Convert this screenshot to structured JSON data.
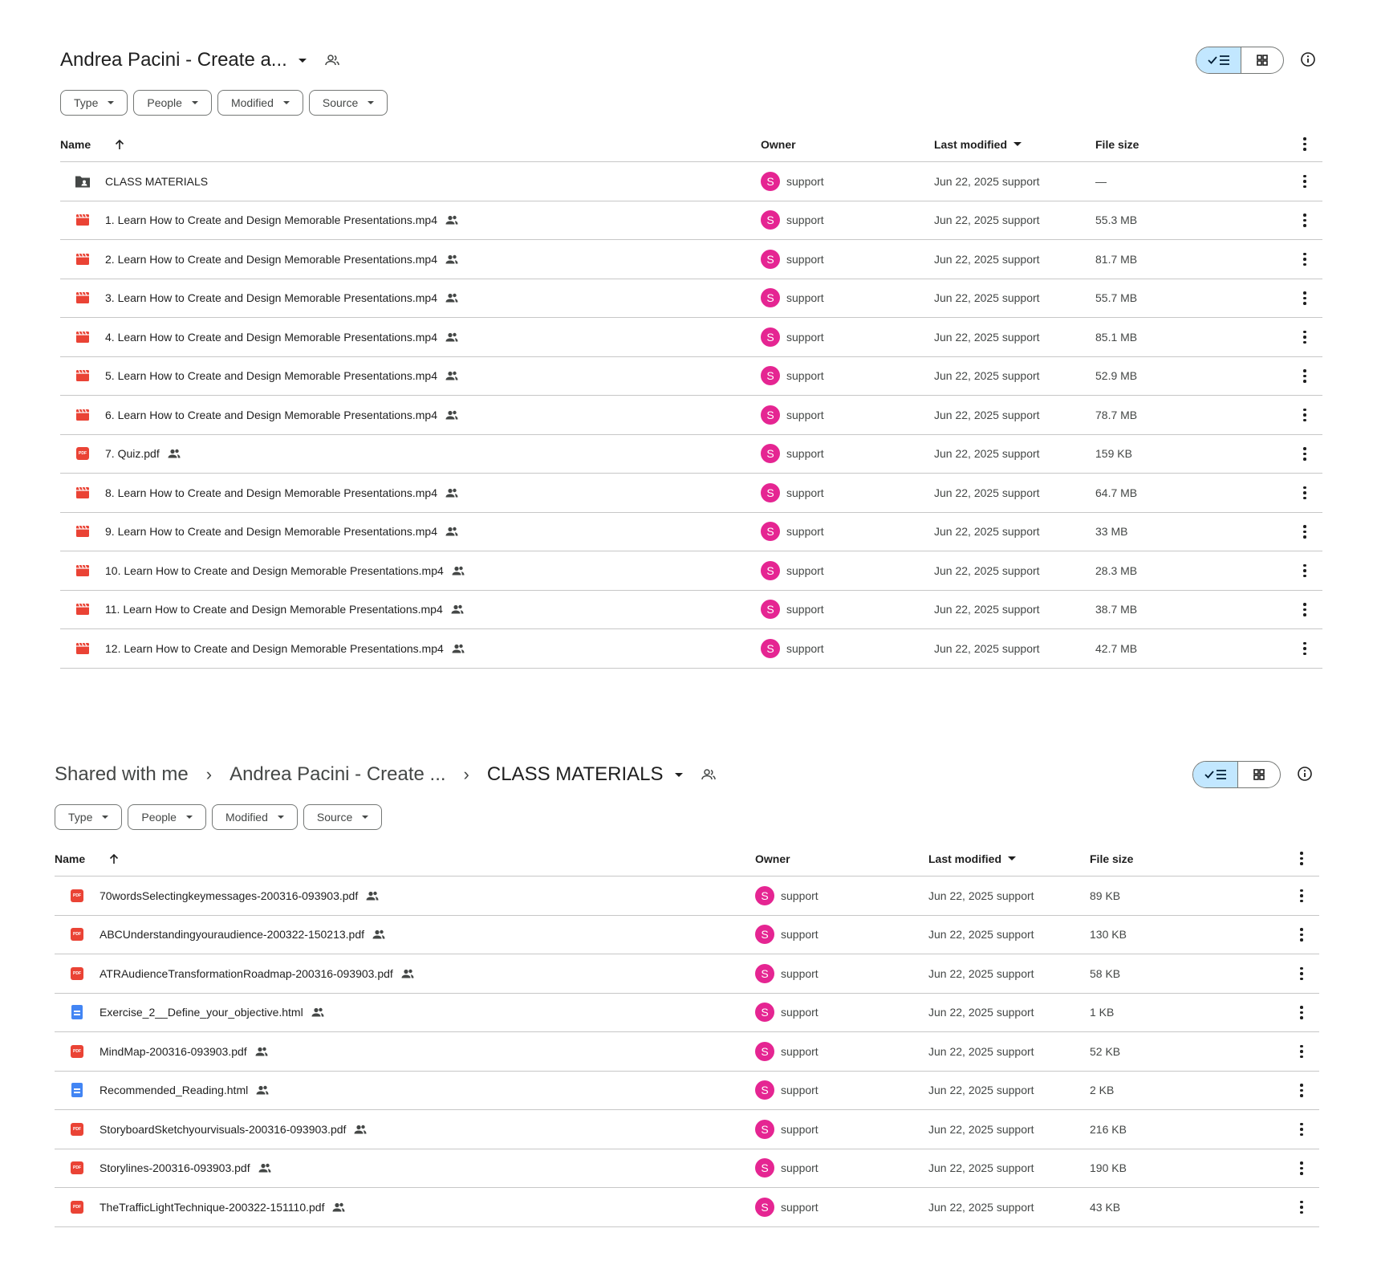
{
  "panel1": {
    "title": "Andrea Pacini - Create a...",
    "filters": [
      "Type",
      "People",
      "Modified",
      "Source"
    ],
    "columns": {
      "name": "Name",
      "owner": "Owner",
      "modified": "Last modified",
      "size": "File size"
    },
    "rows": [
      {
        "type": "shared-folder",
        "name": "CLASS MATERIALS",
        "shared": false,
        "owner": "support",
        "modified": "Jun 22, 2025 support",
        "size": "—"
      },
      {
        "type": "video",
        "name": "1. Learn How to Create and Design Memorable Presentations.mp4",
        "shared": true,
        "owner": "support",
        "modified": "Jun 22, 2025 support",
        "size": "55.3 MB"
      },
      {
        "type": "video",
        "name": "2. Learn How to Create and Design Memorable Presentations.mp4",
        "shared": true,
        "owner": "support",
        "modified": "Jun 22, 2025 support",
        "size": "81.7 MB"
      },
      {
        "type": "video",
        "name": "3. Learn How to Create and Design Memorable Presentations.mp4",
        "shared": true,
        "owner": "support",
        "modified": "Jun 22, 2025 support",
        "size": "55.7 MB"
      },
      {
        "type": "video",
        "name": "4. Learn How to Create and Design Memorable Presentations.mp4",
        "shared": true,
        "owner": "support",
        "modified": "Jun 22, 2025 support",
        "size": "85.1 MB"
      },
      {
        "type": "video",
        "name": "5. Learn How to Create and Design Memorable Presentations.mp4",
        "shared": true,
        "owner": "support",
        "modified": "Jun 22, 2025 support",
        "size": "52.9 MB"
      },
      {
        "type": "video",
        "name": "6. Learn How to Create and Design Memorable Presentations.mp4",
        "shared": true,
        "owner": "support",
        "modified": "Jun 22, 2025 support",
        "size": "78.7 MB"
      },
      {
        "type": "pdf",
        "name": "7. Quiz.pdf",
        "shared": true,
        "owner": "support",
        "modified": "Jun 22, 2025 support",
        "size": "159 KB"
      },
      {
        "type": "video",
        "name": "8. Learn How to Create and Design Memorable Presentations.mp4",
        "shared": true,
        "owner": "support",
        "modified": "Jun 22, 2025 support",
        "size": "64.7 MB"
      },
      {
        "type": "video",
        "name": "9. Learn How to Create and Design Memorable Presentations.mp4",
        "shared": true,
        "owner": "support",
        "modified": "Jun 22, 2025 support",
        "size": "33 MB"
      },
      {
        "type": "video",
        "name": "10. Learn How to Create and Design Memorable Presentations.mp4",
        "shared": true,
        "owner": "support",
        "modified": "Jun 22, 2025 support",
        "size": "28.3 MB"
      },
      {
        "type": "video",
        "name": "11. Learn How to Create and Design Memorable Presentations.mp4",
        "shared": true,
        "owner": "support",
        "modified": "Jun 22, 2025 support",
        "size": "38.7 MB"
      },
      {
        "type": "video",
        "name": "12. Learn How to Create and Design Memorable Presentations.mp4",
        "shared": true,
        "owner": "support",
        "modified": "Jun 22, 2025 support",
        "size": "42.7 MB"
      }
    ]
  },
  "panel2": {
    "breadcrumb": [
      "Shared with me",
      "Andrea Pacini - Create ...",
      "CLASS MATERIALS"
    ],
    "filters": [
      "Type",
      "People",
      "Modified",
      "Source"
    ],
    "columns": {
      "name": "Name",
      "owner": "Owner",
      "modified": "Last modified",
      "size": "File size"
    },
    "rows": [
      {
        "type": "pdf",
        "name": "70wordsSelectingkeymessages-200316-093903.pdf",
        "shared": true,
        "owner": "support",
        "modified": "Jun 22, 2025 support",
        "size": "89 KB"
      },
      {
        "type": "pdf",
        "name": "ABCUnderstandingyouraudience-200322-150213.pdf",
        "shared": true,
        "owner": "support",
        "modified": "Jun 22, 2025 support",
        "size": "130 KB"
      },
      {
        "type": "pdf",
        "name": "ATRAudienceTransformationRoadmap-200316-093903.pdf",
        "shared": true,
        "owner": "support",
        "modified": "Jun 22, 2025 support",
        "size": "58 KB"
      },
      {
        "type": "doc",
        "name": "Exercise_2__Define_your_objective.html",
        "shared": true,
        "owner": "support",
        "modified": "Jun 22, 2025 support",
        "size": "1 KB"
      },
      {
        "type": "pdf",
        "name": "MindMap-200316-093903.pdf",
        "shared": true,
        "owner": "support",
        "modified": "Jun 22, 2025 support",
        "size": "52 KB"
      },
      {
        "type": "doc",
        "name": "Recommended_Reading.html",
        "shared": true,
        "owner": "support",
        "modified": "Jun 22, 2025 support",
        "size": "2 KB"
      },
      {
        "type": "pdf",
        "name": "StoryboardSketchyourvisuals-200316-093903.pdf",
        "shared": true,
        "owner": "support",
        "modified": "Jun 22, 2025 support",
        "size": "216 KB"
      },
      {
        "type": "pdf",
        "name": "Storylines-200316-093903.pdf",
        "shared": true,
        "owner": "support",
        "modified": "Jun 22, 2025 support",
        "size": "190 KB"
      },
      {
        "type": "pdf",
        "name": "TheTrafficLightTechnique-200322-151110.pdf",
        "shared": true,
        "owner": "support",
        "modified": "Jun 22, 2025 support",
        "size": "43 KB"
      }
    ]
  },
  "avatar_letter": "S",
  "pdf_badge_text": "PDF",
  "colors": {
    "avatar": "#e52592",
    "video": "#ea4335",
    "pdf": "#ea4335",
    "doc": "#4285f4",
    "toggle_active": "#c2e7ff"
  }
}
